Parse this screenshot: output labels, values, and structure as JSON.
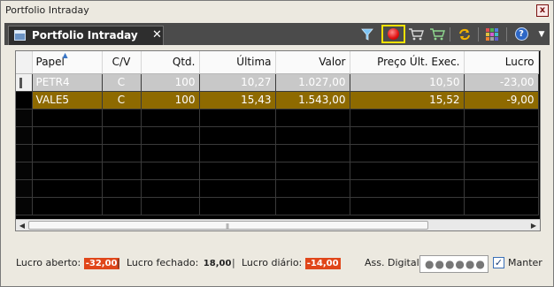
{
  "window": {
    "title": "Portfolio Intraday",
    "close_label": "x"
  },
  "tab": {
    "label": "Portfolio Intraday",
    "close_label": "✕"
  },
  "toolbar": {
    "icons": [
      "filter-icon",
      "record-icon",
      "cart-icon",
      "cart-add-icon",
      "refresh-icon",
      "grid-icon",
      "help-icon",
      "menu-arrow-icon"
    ],
    "help_label": "?",
    "more_label": "▼",
    "grid_colors": [
      "#e05050",
      "#50b050",
      "#5080e0",
      "#e0c040",
      "#d060d0",
      "#40c0c0",
      "#f08030",
      "#a0a0a0",
      "#6060d0"
    ],
    "highlight_color": "#f2e100"
  },
  "table": {
    "columns": [
      "Papel",
      "C/V",
      "Qtd.",
      "Última",
      "Valor",
      "Preço Últ. Exec.",
      "Lucro"
    ],
    "rows": [
      {
        "papel": "PETR4",
        "cv": "C",
        "qtd": "100",
        "ultima": "10,27",
        "valor": "1.027,00",
        "preco": "10,50",
        "lucro": "-23,00"
      },
      {
        "papel": "VALE5",
        "cv": "C",
        "qtd": "100",
        "ultima": "15,43",
        "valor": "1.543,00",
        "preco": "15,52",
        "lucro": "-9,00"
      }
    ],
    "sort_column": "Papel",
    "colors": {
      "selected_row": "#c8c8c8",
      "highlight_row": "#8e6a00",
      "body_bg": "#000000"
    }
  },
  "status": {
    "lucro_aberto_label": "Lucro aberto:",
    "lucro_aberto_value": "-32,00",
    "sep1": "|",
    "lucro_fechado_label": "Lucro fechado:",
    "lucro_fechado_value": "18,00",
    "sep2": "|",
    "lucro_diario_label": "Lucro diário:",
    "lucro_diario_value": "-14,00",
    "ass_digital_label": "Ass. Digital",
    "ass_digital_value": "●●●●●●",
    "manter_label": "Manter",
    "manter_checked": true,
    "negative_color": "#e0461a"
  }
}
